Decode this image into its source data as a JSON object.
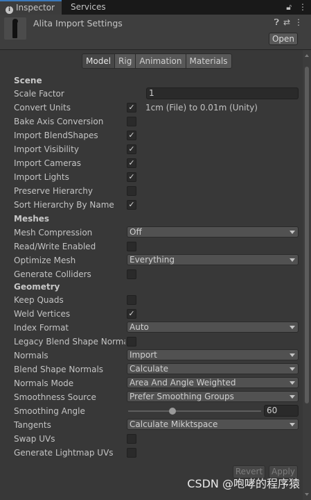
{
  "tabs": {
    "inspector": "Inspector",
    "services": "Services",
    "icons": [
      "lock-icon",
      "more-icon"
    ]
  },
  "header": {
    "title": "Alita Import Settings",
    "open_label": "Open",
    "icons": [
      "help-icon",
      "preset-icon",
      "more-icon"
    ]
  },
  "subtabs": [
    "Model",
    "Rig",
    "Animation",
    "Materials"
  ],
  "scene": {
    "heading": "Scene",
    "scale_factor": {
      "label": "Scale Factor",
      "value": "1"
    },
    "convert_units": {
      "label": "Convert Units",
      "checked": true,
      "note": "1cm (File) to 0.01m (Unity)"
    },
    "bake_axis": {
      "label": "Bake Axis Conversion",
      "checked": false
    },
    "import_blendshapes": {
      "label": "Import BlendShapes",
      "checked": true
    },
    "import_visibility": {
      "label": "Import Visibility",
      "checked": true
    },
    "import_cameras": {
      "label": "Import Cameras",
      "checked": true
    },
    "import_lights": {
      "label": "Import Lights",
      "checked": true
    },
    "preserve_hierarchy": {
      "label": "Preserve Hierarchy",
      "checked": false
    },
    "sort_hierarchy": {
      "label": "Sort Hierarchy By Name",
      "checked": true
    }
  },
  "meshes": {
    "heading": "Meshes",
    "mesh_compression": {
      "label": "Mesh Compression",
      "value": "Off"
    },
    "read_write": {
      "label": "Read/Write Enabled",
      "checked": false
    },
    "optimize_mesh": {
      "label": "Optimize Mesh",
      "value": "Everything"
    },
    "generate_colliders": {
      "label": "Generate Colliders",
      "checked": false
    }
  },
  "geometry": {
    "heading": "Geometry",
    "keep_quads": {
      "label": "Keep Quads",
      "checked": false
    },
    "weld_vertices": {
      "label": "Weld Vertices",
      "checked": true
    },
    "index_format": {
      "label": "Index Format",
      "value": "Auto"
    },
    "legacy_blend": {
      "label": "Legacy Blend Shape Normals",
      "checked": false
    },
    "normals": {
      "label": "Normals",
      "value": "Import"
    },
    "blend_shape_normals": {
      "label": "Blend Shape Normals",
      "value": "Calculate"
    },
    "normals_mode": {
      "label": "Normals Mode",
      "value": "Area And Angle Weighted"
    },
    "smoothness_source": {
      "label": "Smoothness Source",
      "value": "Prefer Smoothing Groups"
    },
    "smoothing_angle": {
      "label": "Smoothing Angle",
      "value": "60",
      "min": 0,
      "max": 180
    },
    "tangents": {
      "label": "Tangents",
      "value": "Calculate Mikktspace"
    },
    "swap_uvs": {
      "label": "Swap UVs",
      "checked": false
    },
    "generate_lightmap_uvs": {
      "label": "Generate Lightmap UVs",
      "checked": false
    }
  },
  "footer": {
    "revert": "Revert",
    "apply": "Apply"
  },
  "watermark": "CSDN @咆哮的程序猿",
  "colors": {
    "background": "#383838",
    "tab_accent": "#3a79bb"
  }
}
